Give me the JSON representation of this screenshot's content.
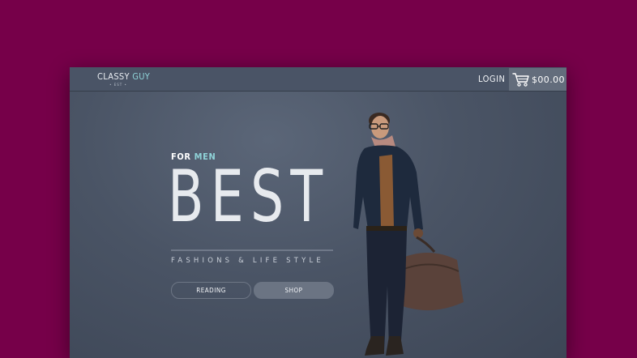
{
  "brand": {
    "name_part1": "CLASSY ",
    "name_part2": "GUY",
    "tagline": "• EST •"
  },
  "nav": {
    "login_label": "LOGIN",
    "cart_amount": "$00.00"
  },
  "hero": {
    "for_label": "FOR ",
    "men_label": "MEN",
    "headline": "BEST",
    "subheadline": "FASHIONS & LIFE STYLE",
    "reading_button": "READING",
    "shop_button": "SHOP"
  },
  "colors": {
    "background": "#760049",
    "accent": "#8fd3d8",
    "panel": "#4a5465"
  }
}
